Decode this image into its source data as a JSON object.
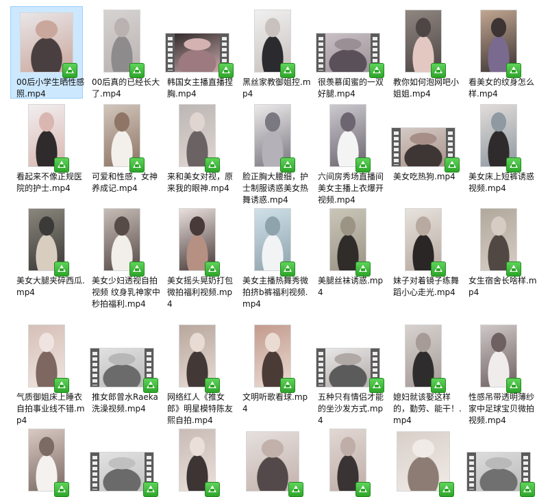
{
  "files": [
    {
      "name": "00后小学生晒性感照.mp4",
      "selected": true,
      "thumb": "portrait-wide",
      "colors": [
        "#e9e6e8",
        "#4a3f40",
        "#caa79c"
      ]
    },
    {
      "name": "00后真的已经长大了.mp4",
      "thumb": "portrait",
      "colors": [
        "#d6d3d2",
        "#8e8b8c",
        "#b9b2b0"
      ]
    },
    {
      "name": "韩国女主播直播捏胸.mp4",
      "thumb": "film",
      "colors": [
        "#2a2426",
        "#9c7a80",
        "#d3b2b1"
      ]
    },
    {
      "name": "黑丝家教御姐控.mp4",
      "thumb": "portrait",
      "colors": [
        "#f0f0f0",
        "#2b2a2e",
        "#c8c1bd"
      ]
    },
    {
      "name": "很羡慕闺蜜的一双好腿.mp4",
      "thumb": "film",
      "colors": [
        "#c9c2c6",
        "#59505a",
        "#9b8f96"
      ]
    },
    {
      "name": "教你如何泡网吧小姐姐.mp4",
      "thumb": "portrait",
      "colors": [
        "#8f8681",
        "#e3c8c1",
        "#4e4644"
      ]
    },
    {
      "name": "看美女的纹身怎么样.mp4",
      "thumb": "portrait",
      "colors": [
        "#c1a690",
        "#7a6a8f",
        "#3d3434"
      ]
    },
    {
      "name": "看起来不像正规医院的护士.mp4",
      "thumb": "portrait",
      "colors": [
        "#f1eef0",
        "#2f2a2c",
        "#d9b7b0"
      ]
    },
    {
      "name": "可爱和性感，女神养成记.mp4",
      "thumb": "portrait",
      "colors": [
        "#d1c5bb",
        "#f3f0ec",
        "#8e7565"
      ]
    },
    {
      "name": "来和美女对视，原来我的眼神.mp4",
      "thumb": "portrait",
      "colors": [
        "#bcb7b5",
        "#6b6264",
        "#e0d5d1"
      ]
    },
    {
      "name": "脸正胸大腰细，护士制服诱惑美女热舞诱惑.mp4",
      "thumb": "portrait",
      "colors": [
        "#ece9ea",
        "#b4b2b8",
        "#7a7881"
      ]
    },
    {
      "name": "六间房秀场直播间 美女主播上衣爆开视频.mp4",
      "thumb": "portrait",
      "colors": [
        "#cbc9cf",
        "#f4f4f4",
        "#6d6670"
      ]
    },
    {
      "name": "美女吃热狗.mp4",
      "thumb": "film",
      "colors": [
        "#d7cdc8",
        "#3e3535",
        "#a78f88"
      ]
    },
    {
      "name": "美女床上短裤诱惑视频.mp4",
      "thumb": "portrait",
      "colors": [
        "#e1dcd9",
        "#2f2b2c",
        "#8f99a2"
      ]
    },
    {
      "name": "美女大腿夹碎西瓜.mp4",
      "thumb": "portrait",
      "colors": [
        "#8a867c",
        "#d8cdbf",
        "#3c3a38"
      ]
    },
    {
      "name": "美女少妇透视自拍视频 纹身乳神家中秒拍福利.mp4",
      "thumb": "portrait",
      "colors": [
        "#c6bcb6",
        "#f2eee9",
        "#574b48"
      ]
    },
    {
      "name": "美女摇头晃奶打包微拍福利视频.mp4",
      "thumb": "portrait",
      "colors": [
        "#e9dfdd",
        "#b79084",
        "#473a38"
      ]
    },
    {
      "name": "美女主播热舞秀微拍挤b裤福利视频.mp4",
      "thumb": "portrait",
      "colors": [
        "#cfe0e8",
        "#f1f3f4",
        "#8fa3ad"
      ]
    },
    {
      "name": "美腿丝袜诱惑.mp4",
      "thumb": "portrait",
      "colors": [
        "#c9c6b8",
        "#2f2c29",
        "#9b9485"
      ]
    },
    {
      "name": "妹子对着镜子练舞蹈小心走光.mp4",
      "thumb": "portrait",
      "colors": [
        "#e7e2dd",
        "#2a2626",
        "#b8aaa0"
      ]
    },
    {
      "name": "女生宿舍长啥样.mp4",
      "thumb": "portrait",
      "colors": [
        "#b2a99d",
        "#514844",
        "#d6ccc3"
      ]
    },
    {
      "name": "气质御姐床上睡衣自拍事业线不错.mp4",
      "thumb": "portrait",
      "colors": [
        "#d6c0b8",
        "#7e6760",
        "#efe4df"
      ]
    },
    {
      "name": "推女郎曾水Raeka洗澡视频.mp4",
      "thumb": "film",
      "colors": [
        "#e3e3e3",
        "#6b6b6b",
        "#b7b7b7"
      ]
    },
    {
      "name": "网络红人《推女郎》明星模特陈友熙自拍.mp4",
      "thumb": "portrait",
      "colors": [
        "#b8a79d",
        "#423937",
        "#e7dbd3"
      ]
    },
    {
      "name": "文明听歌看球.mp4",
      "thumb": "portrait",
      "colors": [
        "#c39b8d",
        "#4b3b37",
        "#eadbd3"
      ]
    },
    {
      "name": "五种只有情侣才能的坐沙发方式.mp4",
      "thumb": "film",
      "colors": [
        "#eaeaea",
        "#5b5b5b",
        "#b0a8a5"
      ]
    },
    {
      "name": "媳妇就该娶这样的，勤劳、能干！.mp4",
      "thumb": "portrait",
      "colors": [
        "#d7d2cf",
        "#2f2c2d",
        "#a69b97"
      ]
    },
    {
      "name": "性感吊带透明薄纱家中足球宝贝微拍视频.mp4",
      "thumb": "portrait",
      "colors": [
        "#cfc7c7",
        "#f1ecec",
        "#6f6161"
      ]
    },
    {
      "name": "",
      "thumb": "portrait",
      "colors": [
        "#d9c9c3",
        "#f4f1ef",
        "#7c6a64"
      ]
    },
    {
      "name": "",
      "thumb": "film",
      "colors": [
        "#e4e4e4",
        "#6a6a6a",
        "#c0c0c0"
      ]
    },
    {
      "name": "",
      "thumb": "portrait",
      "colors": [
        "#c9bcb7",
        "#3d3434",
        "#eadfd9"
      ]
    },
    {
      "name": "",
      "thumb": "portrait-wide",
      "colors": [
        "#e6e0de",
        "#53494a",
        "#c2b1ab"
      ]
    },
    {
      "name": "",
      "thumb": "portrait",
      "colors": [
        "#e1d7d3",
        "#3a3333",
        "#bfaea8"
      ]
    },
    {
      "name": "",
      "thumb": "portrait-wide",
      "colors": [
        "#d8cfc8",
        "#8c7c74",
        "#f1ebe7"
      ]
    },
    {
      "name": "",
      "thumb": "film",
      "colors": [
        "#dedede",
        "#707070",
        "#b9b9b9"
      ]
    }
  ],
  "colors": {
    "selection": "#cce8ff",
    "badge": "#2ea52a",
    "film_strip": "#5b5b5b"
  }
}
